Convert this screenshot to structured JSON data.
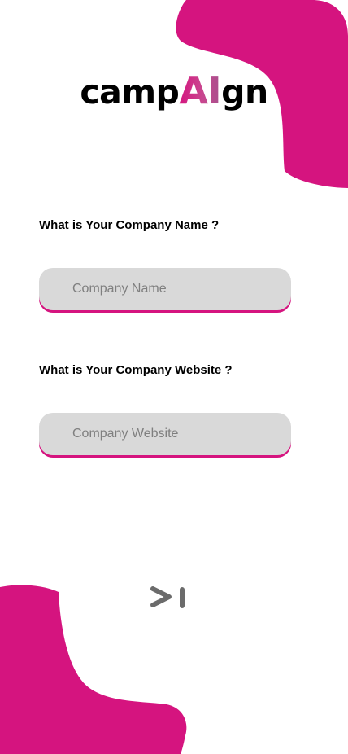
{
  "app": {
    "logo_prefix": "camp",
    "logo_highlight": "AI",
    "logo_suffix": "gn"
  },
  "form": {
    "company_name_question": "What is Your Company Name ?",
    "company_name_placeholder": "Company Name",
    "company_name_value": "",
    "company_website_question": "What is Your Company Website ?",
    "company_website_placeholder": "Company Website",
    "company_website_value": ""
  },
  "next_button": {
    "icon": "skip-next-icon"
  },
  "colors": {
    "accent": "#d5147f",
    "field_background": "#d9d9d9",
    "placeholder_text": "#7f7f7f",
    "icon_gray": "#6b6b6b"
  }
}
